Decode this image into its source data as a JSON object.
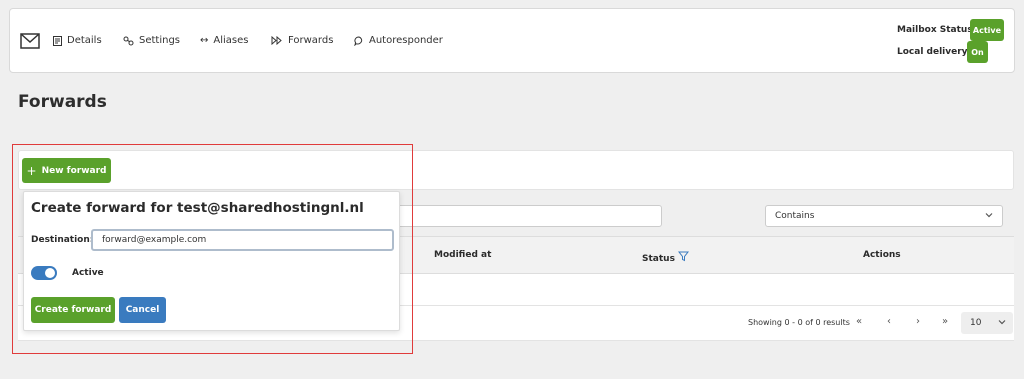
{
  "nav": {
    "items": [
      {
        "label": "Details",
        "icon": "details-icon"
      },
      {
        "label": "Settings",
        "icon": "settings-icon"
      },
      {
        "label": "Aliases",
        "icon": "arrows-icon"
      },
      {
        "label": "Forwards",
        "icon": "forward-icon"
      },
      {
        "label": "Autoresponder",
        "icon": "chat-icon"
      }
    ],
    "mailbox_status_label": "Mailbox Status:",
    "mailbox_status_value": "Active",
    "local_delivery_label": "Local delivery:",
    "local_delivery_value": "On"
  },
  "page": {
    "title": "Forwards"
  },
  "toolbar": {
    "new_forward_label": "New forward"
  },
  "filter": {
    "select_value": "Contains"
  },
  "table": {
    "columns": [
      "Modified at",
      "Status",
      "Actions"
    ],
    "rows": []
  },
  "pagination": {
    "summary": "Showing 0 - 0 of 0 results",
    "per_page": "10"
  },
  "popup": {
    "title": "Create forward for test@sharedhostingnl.nl",
    "destination_label": "Destination:",
    "destination_value": "forward@example.com",
    "active_label": "Active",
    "active_on": true,
    "create_label": "Create forward",
    "cancel_label": "Cancel"
  },
  "colors": {
    "green": "#5aa12b",
    "blue": "#3a7bbf",
    "highlight_red": "#e03b3b"
  }
}
